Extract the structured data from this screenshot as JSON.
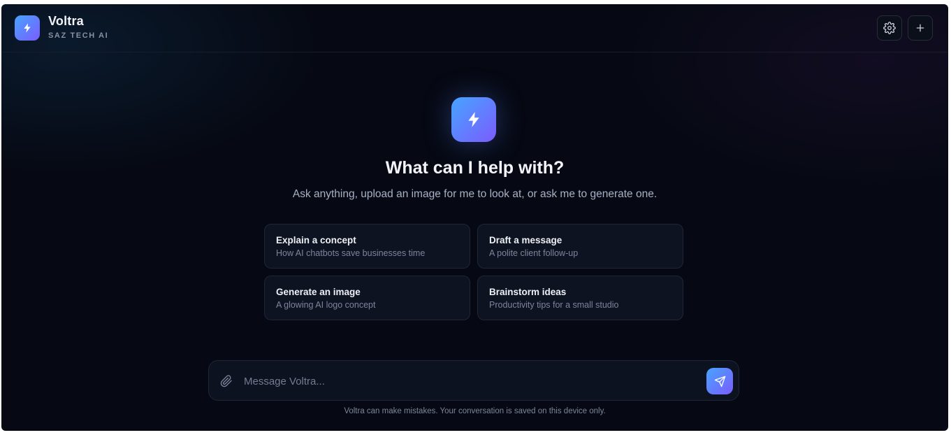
{
  "app": {
    "name": "Voltra",
    "subtitle": "SAZ TECH AI",
    "brand_gradient": [
      "#46a4ff",
      "#7b5cff"
    ],
    "background": "#060913"
  },
  "header": {
    "buttons": [
      {
        "name": "settings",
        "icon": "gear-icon"
      },
      {
        "name": "new-chat",
        "icon": "plus-icon"
      }
    ]
  },
  "hero": {
    "icon": "lightning-bolt-icon",
    "title": "What can I help with?",
    "subtitle": "Ask anything, upload an image for me to look at, or ask me to generate one."
  },
  "suggestions": [
    {
      "title": "Explain a concept",
      "subtitle": "How AI chatbots save businesses time"
    },
    {
      "title": "Draft a message",
      "subtitle": "A polite client follow-up"
    },
    {
      "title": "Generate an image",
      "subtitle": "A glowing AI logo concept"
    },
    {
      "title": "Brainstorm ideas",
      "subtitle": "Productivity tips for a small studio"
    }
  ],
  "composer": {
    "placeholder": "Message Voltra...",
    "value": "",
    "attach_icon": "paperclip-icon",
    "send_icon": "send-icon"
  },
  "footer": {
    "disclaimer": "Voltra can make mistakes. Your conversation is saved on this device only."
  }
}
